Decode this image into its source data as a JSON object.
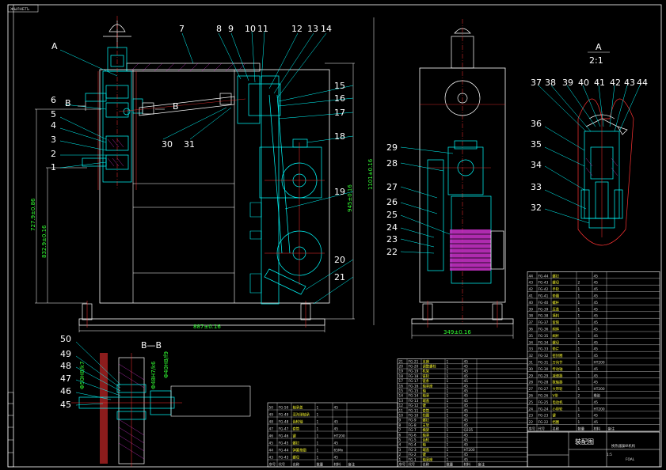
{
  "drawing": {
    "top_left_tag": "ЖЫЛНБТЪ",
    "section_A_label": "A",
    "section_B_label": "B",
    "section_B2_label": "B",
    "detail_A_title": "A",
    "detail_A_scale": "2:1",
    "section_BB_title": "B—B",
    "part_numbers_main": [
      "1",
      "2",
      "3",
      "4",
      "5",
      "6",
      "7",
      "8",
      "9",
      "10",
      "11",
      "12",
      "13",
      "14",
      "15",
      "16",
      "17",
      "18",
      "19",
      "20",
      "21",
      "30",
      "31"
    ],
    "part_numbers_side": [
      "22",
      "23",
      "24",
      "25",
      "26",
      "27",
      "28",
      "29"
    ],
    "part_numbers_detail": [
      "32",
      "33",
      "34",
      "35",
      "36",
      "37",
      "38",
      "39",
      "40",
      "41",
      "42",
      "43",
      "44"
    ],
    "part_numbers_bb": [
      "45",
      "46",
      "47",
      "48",
      "49",
      "50"
    ],
    "dim_width_main": "887±0.16",
    "dim_width_side": "349±0.16",
    "dim_height_1": "727.9±0.86",
    "dim_height_2": "832.9±0.16",
    "dim_height_3": "945±0.16",
    "dim_height_4": "1101±0.16",
    "dim_bb_1": "Ф50H8/k7",
    "dim_bb_2": "Ф48H7/k6",
    "dim_bb_3": "Ф40H8/f9"
  },
  "title_block": {
    "drawing_title": "装配图",
    "product_name": "换热器操纵机构",
    "scale": "1:5",
    "code": "FOAL"
  },
  "bom_right": {
    "rows": [
      [
        "44",
        "FG-44",
        "螺钉",
        "",
        "45"
      ],
      [
        "43",
        "FG-43",
        "螺母",
        "2",
        "45"
      ],
      [
        "42",
        "FG-42",
        "手轮",
        "1",
        "45"
      ],
      [
        "41",
        "FG-41",
        "垫圈",
        "1",
        "45"
      ],
      [
        "40",
        "FG-40",
        "螺杆",
        "1",
        "45"
      ],
      [
        "39",
        "FG-39",
        "压盖",
        "1",
        "45"
      ],
      [
        "38",
        "FG-38",
        "填料",
        "1",
        "45"
      ],
      [
        "37",
        "FG-37",
        "套筒",
        "1",
        "45"
      ],
      [
        "36",
        "FG-36",
        "阀体",
        "1",
        "45"
      ],
      [
        "35",
        "FG-35",
        "阀杆",
        "1",
        "45"
      ],
      [
        "34",
        "FG-34",
        "螺母",
        "1",
        "45"
      ],
      [
        "33",
        "FG-33",
        "垫片",
        "1",
        "45"
      ],
      [
        "32",
        "FG-32",
        "密封圈",
        "1",
        "45"
      ],
      [
        "31",
        "FG-31",
        "万向节",
        "1",
        "HT200"
      ],
      [
        "30",
        "FG-30",
        "传动轴",
        "1",
        "45"
      ],
      [
        "29",
        "FG-29",
        "减速器",
        "1",
        "45"
      ],
      [
        "28",
        "FG-28",
        "联轴器",
        "1",
        "45"
      ],
      [
        "27",
        "FG-27",
        "大带轮",
        "1",
        "HT200"
      ],
      [
        "26",
        "FG-26",
        "V带",
        "2",
        "橡胶"
      ],
      [
        "25",
        "FG-25",
        "电动机",
        "1",
        "45"
      ],
      [
        "24",
        "FG-24",
        "小带轮",
        "1",
        "HT200"
      ],
      [
        "23",
        "FG-23",
        "键",
        "1",
        "45"
      ],
      [
        "22",
        "FG-22",
        "挡圈",
        "1",
        "45"
      ]
    ],
    "header": [
      "序号",
      "代号",
      "名称",
      "数量",
      "材料",
      "备注"
    ]
  },
  "bom_middle": {
    "rows": [
      [
        "21",
        "FG-21",
        "支座",
        "1",
        "45"
      ],
      [
        "20",
        "FG-20",
        "调整螺栓",
        "1",
        "45"
      ],
      [
        "19",
        "FG-19",
        "机架",
        "1",
        "45"
      ],
      [
        "18",
        "FG-18",
        "链轮",
        "1",
        "45"
      ],
      [
        "17",
        "FG-17",
        "链条",
        "1",
        "45"
      ],
      [
        "16",
        "FG-16",
        "轴承座",
        "1",
        "45"
      ],
      [
        "15",
        "FG-15",
        "轴",
        "1",
        "45"
      ],
      [
        "14",
        "FG-14",
        "轴承",
        "1",
        "45"
      ],
      [
        "13",
        "FG-13",
        "端盖",
        "1",
        "45"
      ],
      [
        "12",
        "FG-12",
        "键",
        "1",
        "45"
      ],
      [
        "11",
        "FG-11",
        "套筒",
        "1",
        "45"
      ],
      [
        "10",
        "FG-10",
        "挡圈",
        "1",
        "45"
      ],
      [
        "9",
        "FG-9",
        "螺钉",
        "1",
        "45"
      ],
      [
        "8",
        "FG-8",
        "支架",
        "1",
        "45"
      ],
      [
        "7",
        "FG-7",
        "横梁",
        "1",
        "Q235"
      ],
      [
        "6",
        "FG-6",
        "轴承",
        "1",
        "45"
      ],
      [
        "5",
        "FG-5",
        "齿轮",
        "1",
        "45"
      ],
      [
        "4",
        "FG-4",
        "轴",
        "1",
        "45"
      ],
      [
        "3",
        "FG-3",
        "端盖",
        "1",
        "HT200"
      ],
      [
        "2",
        "FG-2",
        "键",
        "1",
        "45"
      ],
      [
        "1",
        "FG-1",
        "轴承座",
        "1",
        "45"
      ]
    ],
    "header": [
      "序号",
      "代号",
      "名称",
      "数量",
      "材料",
      "备注"
    ]
  },
  "bom_left": {
    "rows": [
      [
        "50",
        "FG-50",
        "轴承盖",
        "1",
        "45"
      ],
      [
        "49",
        "FG-49",
        "深沟球轴承",
        "1",
        ""
      ],
      [
        "48",
        "FG-48",
        "齿轮轴",
        "1",
        "45"
      ],
      [
        "47",
        "FG-47",
        "套筒",
        "1",
        "45"
      ],
      [
        "46",
        "FG-46",
        "键",
        "1",
        "HT200"
      ],
      [
        "45",
        "FG-45",
        "螺钉",
        "1",
        "45"
      ],
      [
        "44",
        "FG-44",
        "弹簧垫圈",
        "1",
        "65Mn"
      ],
      [
        "43",
        "FG-43",
        "螺母",
        "1",
        "45"
      ]
    ],
    "header": [
      "序号",
      "代号",
      "名称",
      "数量",
      "材料",
      "备注"
    ]
  },
  "colors": {
    "background": "#000000",
    "outline": "#ffffff",
    "part_color": "#00ffff",
    "leader_color": "#00ffff",
    "center_color": "#ff3333",
    "dim_color": "#33ff33",
    "motor_color": "#cc33cc",
    "table_line": "#ffffff"
  }
}
